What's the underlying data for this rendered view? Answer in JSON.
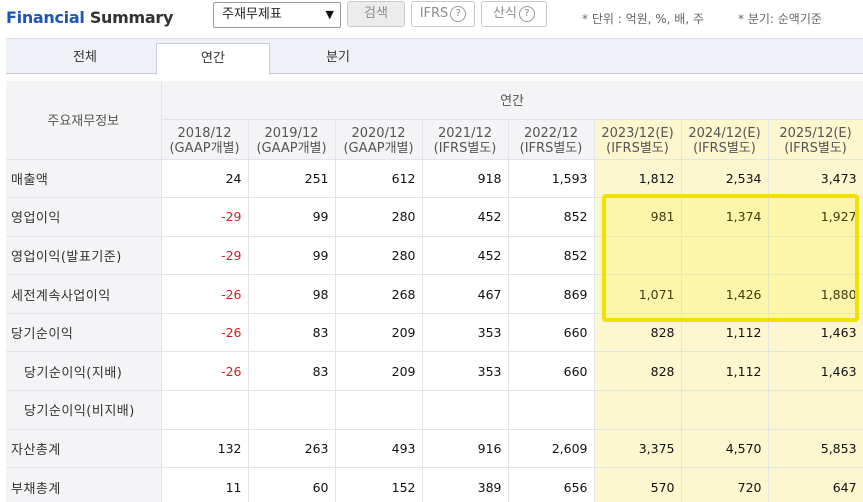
{
  "header": {
    "title_part1": "Financial",
    "title_part2": "Summary",
    "select_value": "주재무제표",
    "search_label": "검색",
    "ifrs_label": "IFRS",
    "calc_label": "산식",
    "help_glyph": "?",
    "unit_note": "* 단위 : 억원, %, 배, 주",
    "period_note": "* 분기: 순액기준"
  },
  "tabs": [
    {
      "label": "전체"
    },
    {
      "label": "연간"
    },
    {
      "label": "분기"
    }
  ],
  "table": {
    "row_header_label": "주요재무정보",
    "group_label": "연간",
    "columns": [
      {
        "period": "2018/12",
        "basis": "(GAAP개별)"
      },
      {
        "period": "2019/12",
        "basis": "(GAAP개별)"
      },
      {
        "period": "2020/12",
        "basis": "(GAAP개별)"
      },
      {
        "period": "2021/12",
        "basis": "(IFRS별도)"
      },
      {
        "period": "2022/12",
        "basis": "(IFRS별도)"
      },
      {
        "period": "2023/12(E)",
        "basis": "(IFRS별도)"
      },
      {
        "period": "2024/12(E)",
        "basis": "(IFRS별도)"
      },
      {
        "period": "2025/12(E)",
        "basis": "(IFRS별도)"
      }
    ],
    "rows": [
      {
        "label": "매출액",
        "values": [
          "24",
          "251",
          "612",
          "918",
          "1,593",
          "1,812",
          "2,534",
          "3,473"
        ]
      },
      {
        "label": "영업이익",
        "values": [
          "-29",
          "99",
          "280",
          "452",
          "852",
          "981",
          "1,374",
          "1,927"
        ]
      },
      {
        "label": "영업이익(발표기준)",
        "values": [
          "-29",
          "99",
          "280",
          "452",
          "852",
          "",
          "",
          ""
        ]
      },
      {
        "label": "세전계속사업이익",
        "values": [
          "-26",
          "98",
          "268",
          "467",
          "869",
          "1,071",
          "1,426",
          "1,880"
        ]
      },
      {
        "label": "당기순이익",
        "values": [
          "-26",
          "83",
          "209",
          "353",
          "660",
          "828",
          "1,112",
          "1,463"
        ]
      },
      {
        "label": "당기순이익(지배)",
        "values": [
          "-26",
          "83",
          "209",
          "353",
          "660",
          "828",
          "1,112",
          "1,463"
        ]
      },
      {
        "label": "당기순이익(비지배)",
        "values": [
          "",
          "",
          "",
          "",
          "",
          "",
          "",
          ""
        ]
      },
      {
        "label": "자산총계",
        "values": [
          "132",
          "263",
          "493",
          "916",
          "2,609",
          "3,375",
          "4,570",
          "5,853"
        ]
      },
      {
        "label": "부채총계",
        "values": [
          "11",
          "60",
          "152",
          "389",
          "656",
          "570",
          "720",
          "647"
        ]
      }
    ]
  },
  "colors": {
    "title_blue": "#1d56b5",
    "estimate_fill": "#fdf7d0",
    "highlight": "#f2e000",
    "negative": "#d32020"
  }
}
